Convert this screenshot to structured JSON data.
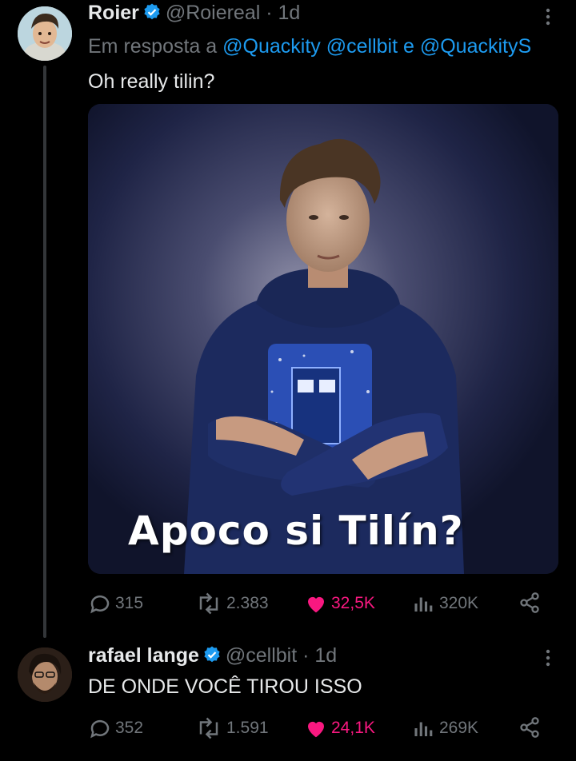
{
  "tweet1": {
    "author_name": "Roier",
    "handle_time": "@Roiereal · 1d",
    "reply_prefix": "Em resposta a",
    "mentions": [
      "@Quackity",
      "@cellbit",
      "@QuackityS"
    ],
    "reply_joiner": "e",
    "text": "Oh really tilin?",
    "image_caption": "Apoco si Tilín?",
    "actions": {
      "replies": "315",
      "reposts": "2.383",
      "likes": "32,5K",
      "views": "320K"
    }
  },
  "tweet2": {
    "author_name": "rafael lange",
    "handle_time": "@cellbit · 1d",
    "text": "DE ONDE VOCÊ TIROU ISSO",
    "actions": {
      "replies": "352",
      "reposts": "1.591",
      "likes": "24,1K",
      "views": "269K"
    }
  },
  "colors": {
    "background": "#000000",
    "accent": "#1d9bf0",
    "like": "#f91880",
    "muted": "#71767b"
  }
}
